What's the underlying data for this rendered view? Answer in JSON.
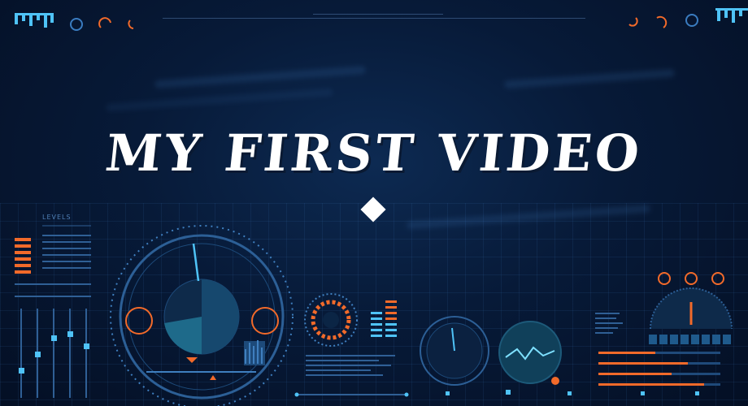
{
  "title": "MY FIRST VIDEO",
  "hud": {
    "levels_label": "LEVELS"
  },
  "colors": {
    "background": "#071a38",
    "accent_cyan": "#4fc3f7",
    "accent_orange": "#f26a2a",
    "title_text": "#ffffff"
  },
  "icons": [
    "diamond-icon",
    "radar-dial-icon",
    "pulse-gauge-icon",
    "needle-gauge-icon",
    "wave-monitor-icon",
    "half-gauge-icon",
    "bar-meter-icon"
  ]
}
